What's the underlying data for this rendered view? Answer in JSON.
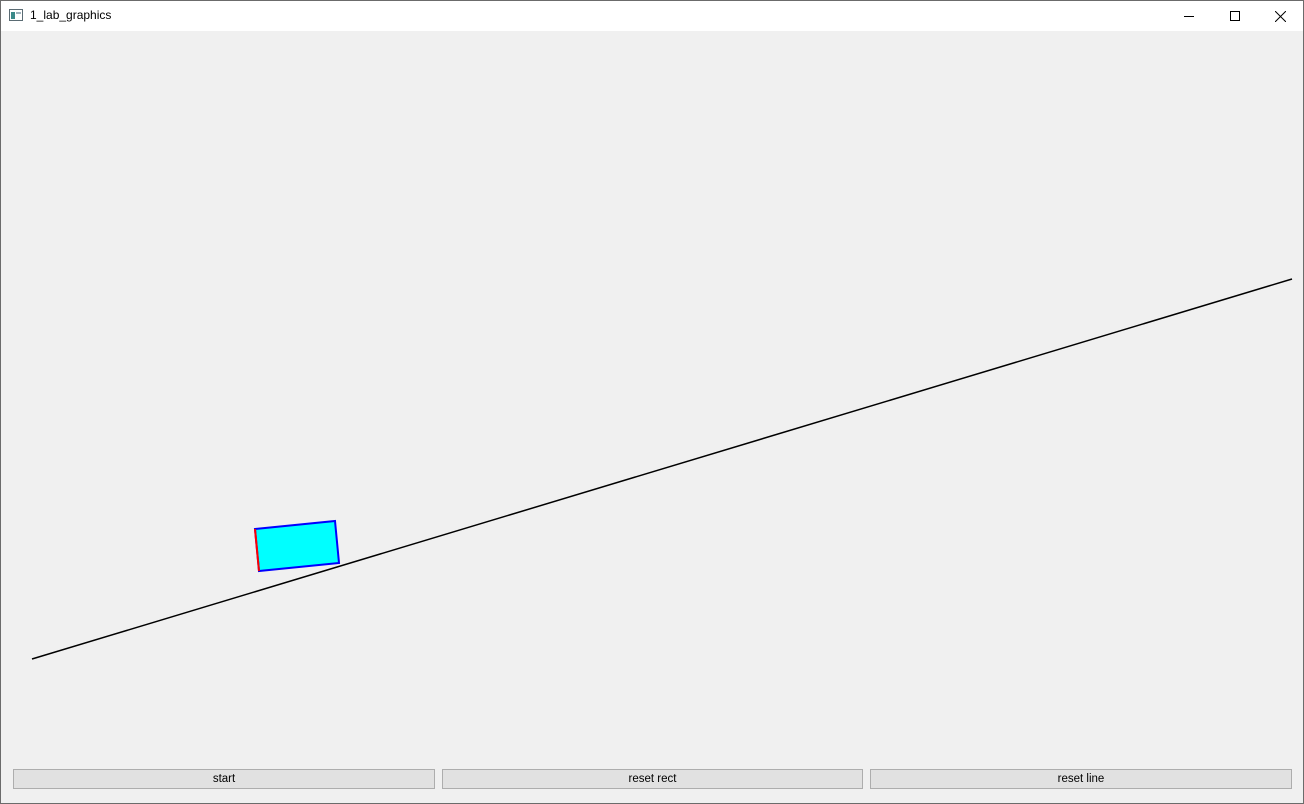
{
  "window": {
    "title": "1_lab_graphics",
    "controls": {
      "minimize_icon": "minimize-icon",
      "maximize_icon": "maximize-icon",
      "close_icon": "close-icon"
    }
  },
  "scene": {
    "background": "#f0f0f0",
    "line_color": "#000000",
    "rect_fill": "#00ffff",
    "rect_stroke": "#0000ff",
    "rect_edge_highlight": "#ff0000"
  },
  "buttons": {
    "start": "start",
    "reset_rect": "reset rect",
    "reset_line": "reset line"
  }
}
